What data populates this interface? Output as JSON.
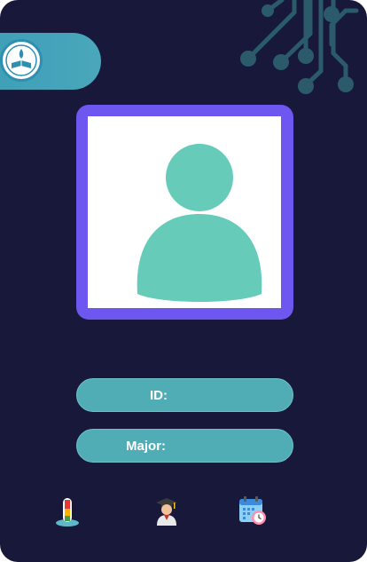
{
  "card": {
    "fields": {
      "id_label": "ID:",
      "id_value": "",
      "major_label": "Major:",
      "major_value": ""
    },
    "icons": [
      "thermometer-icon",
      "graduate-student-icon",
      "calendar-clock-icon"
    ],
    "colors": {
      "background": "#17183a",
      "accent_teal": "#51adb5",
      "photo_frame": "#6e57f0",
      "avatar": "#66cbb9",
      "circuit": "#2b5b6a"
    }
  }
}
